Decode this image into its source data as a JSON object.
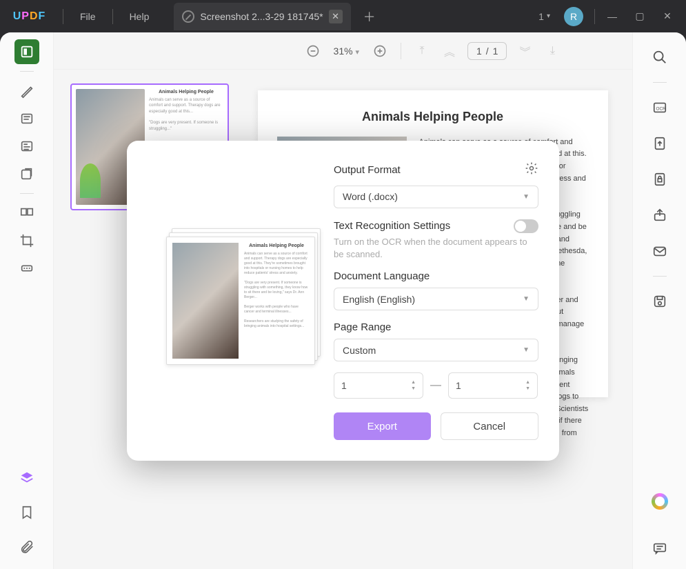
{
  "titlebar": {
    "logo": "UPDF",
    "menu": {
      "file": "File",
      "help": "Help"
    },
    "tab": {
      "label": "Screenshot 2...3-29 181745*"
    },
    "avatar_letter": "R",
    "tab_count": "1"
  },
  "toolbar": {
    "zoom": "31%",
    "current_page": "1",
    "total_pages": "1",
    "page_sep": "/"
  },
  "document": {
    "title": "Animals Helping People",
    "para1": "Animals can serve as a source of comfort and support. Therapy dogs are especially good at this. They're sometimes brought into hospitals or nursing homes to help reduce patients' stress and anxiety.",
    "para2": "\"Dogs are very present. If someone is struggling with something, they know how to sit there and be loving,\" says Dr. Ann Berger, a physician and researcher at the NIH Clinical Center in Bethesda, Maryland. \"Their attention is focused on the person all the time.\"",
    "para3": "Berger works with people who have cancer and terminal illnesses. She teaches them about mindfulness to help decrease stress and manage pain.",
    "para4": "Researchers are studying the safety of bringing animals into hospital settings because animals may expose people to more germs. A current study is looking at the safety of bringing dogs to visit children with cancer, Esposito says. Scientists will be testing the children's hands to see if there are dangerous levels of germs transferred from the dog after the visit."
  },
  "modal": {
    "output_format_label": "Output Format",
    "output_format_value": "Word (.docx)",
    "text_recog_label": "Text Recognition Settings",
    "text_recog_hint": "Turn on the OCR when the document appears to be scanned.",
    "doc_lang_label": "Document Language",
    "doc_lang_value": "English (English)",
    "page_range_label": "Page Range",
    "page_range_value": "Custom",
    "range_from": "1",
    "range_to": "1",
    "range_dash": "—",
    "export": "Export",
    "cancel": "Cancel",
    "preview_title": "Animals Helping People"
  }
}
